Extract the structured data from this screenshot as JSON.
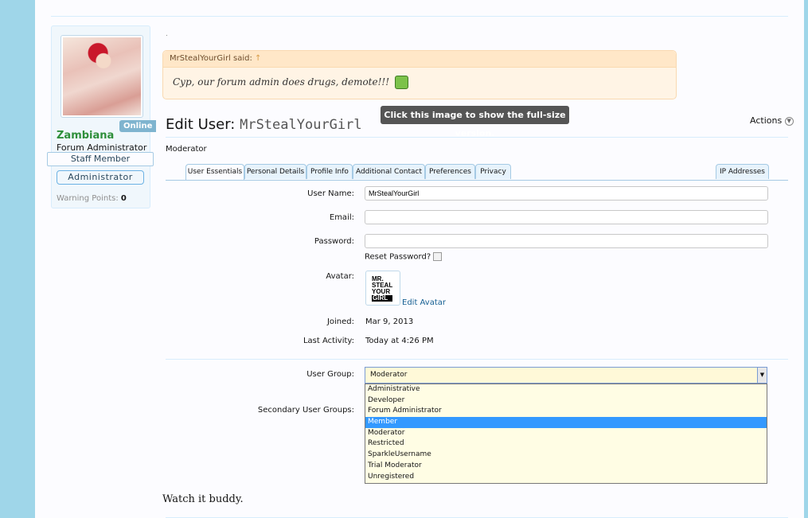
{
  "sidebar": {
    "status": "Online",
    "username": "Zambiana",
    "user_title": "Forum Administrator",
    "staff_badge": "Staff Member",
    "banner": "Administrator",
    "warning_label": "Warning Points:",
    "warning_value": "0"
  },
  "quote": {
    "author_said": "MrStealYourGirl said:",
    "arrow": "↑",
    "text": "Cyp, our forum admin does drugs, demote!!!"
  },
  "tooltip": "Click this image to show the full-size version.",
  "edit": {
    "title_prefix": "Edit User:",
    "title_user": "MrStealYourGirl",
    "actions": "Actions",
    "role": "Moderator"
  },
  "tabs": [
    "User Essentials",
    "Personal Details",
    "Profile Info",
    "Additional Contact",
    "Preferences",
    "Privacy",
    "IP Addresses"
  ],
  "form": {
    "username_label": "User Name:",
    "username_value": "MrStealYourGirl",
    "email_label": "Email:",
    "email_value": "",
    "password_label": "Password:",
    "password_value": "",
    "reset_label": "Reset Password?",
    "avatar_label": "Avatar:",
    "avatar_logo": [
      "MR.",
      "STEAL",
      "YOUR",
      "GIRL"
    ],
    "edit_avatar": "Edit Avatar",
    "joined_label": "Joined:",
    "joined_value": "Mar 9, 2013",
    "last_activity_label": "Last Activity:",
    "last_activity_value": "Today at 4:26 PM",
    "user_group_label": "User Group:",
    "user_group_value": "Moderator",
    "secondary_label": "Secondary User Groups:",
    "options": [
      "Administrative",
      "Developer",
      "Forum Administrator",
      "Member",
      "Moderator",
      "Restricted",
      "SparkleUsername",
      "Trial Moderator",
      "Unregistered"
    ],
    "highlighted_option": "Member"
  },
  "post_text": "Watch it buddy."
}
